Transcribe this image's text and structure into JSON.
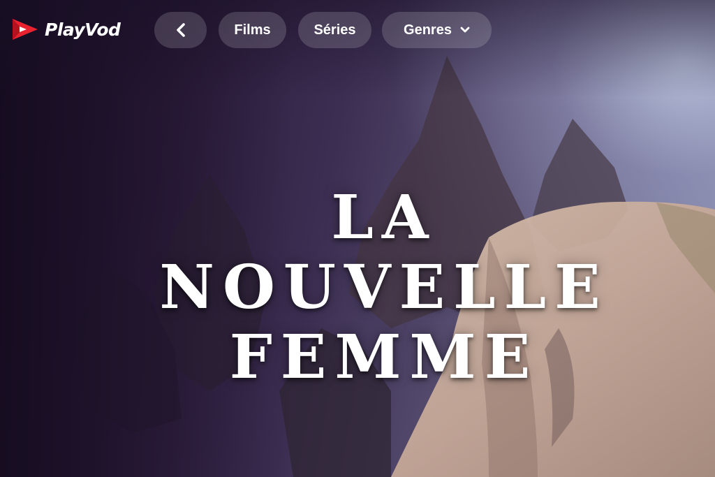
{
  "brand": {
    "name": "PlayVod",
    "accent": "#e8232f"
  },
  "nav": {
    "back_icon": "chevron-left-icon",
    "films_label": "Films",
    "series_label": "Séries",
    "genres_label": "Genres",
    "genres_icon": "chevron-down-icon"
  },
  "hero": {
    "title_lines": [
      "LA",
      "NOUVELLE",
      "FEMME"
    ]
  }
}
